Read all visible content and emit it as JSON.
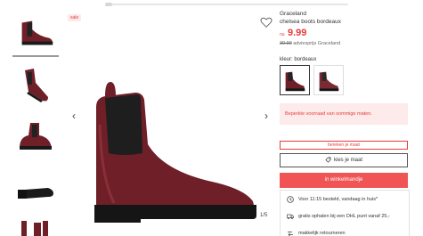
{
  "product": {
    "brand": "Graceland",
    "name": "chelsea boots bordeaux",
    "price_prefix": "nu",
    "price": "9.99",
    "old_price": "39.99",
    "advice_text": "adviesprijs Graceland",
    "color_label": "kleur: bordeaux",
    "sale_badge": "sale",
    "image_counter": "1/5"
  },
  "gallery": {
    "thumbnails": [
      {
        "icon": "boot-side-view"
      },
      {
        "icon": "boot-angle-view"
      },
      {
        "icon": "boot-back-view"
      },
      {
        "icon": "boot-sole-view"
      },
      {
        "icon": "boot-detail-view"
      }
    ]
  },
  "swatches": [
    {
      "icon": "boot-swatch-bordeaux",
      "selected": true
    },
    {
      "icon": "boot-swatch-alt",
      "selected": false
    }
  ],
  "notice": "Beperkte voorraad van sommige maten.",
  "actions": {
    "size_calc": "bereken je maat",
    "choose_size": "kies je maat",
    "add_to_cart": "in winkelmandje"
  },
  "usps": [
    {
      "icon": "clock-icon",
      "text": "Voor 11:15 besteld, vandaag in huis*"
    },
    {
      "icon": "truck-icon",
      "text": "gratis ophalen bij een DHL punt vanaf 25,-"
    },
    {
      "icon": "return-icon",
      "text": "makkelijk retourneren"
    }
  ],
  "colors": {
    "accent": "#e63c3c",
    "cart": "#f05454",
    "boot": "#6e1f27"
  }
}
